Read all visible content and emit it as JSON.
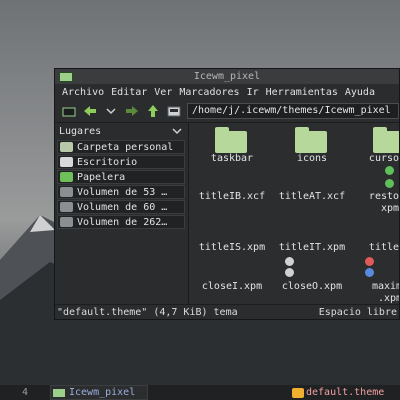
{
  "window": {
    "title": "Icewm_pixel"
  },
  "menu": [
    "Archivo",
    "Editar",
    "Ver",
    "Marcadores",
    "Ir",
    "Herramientas",
    "Ayuda"
  ],
  "toolbar": {
    "path": "/home/j/.icewm/themes/Icewm_pixel"
  },
  "sidebar": {
    "header": "Lugares",
    "items": [
      {
        "label": "Carpeta personal",
        "icon": "home-icon"
      },
      {
        "label": "Escritorio",
        "icon": "desktop-icon"
      },
      {
        "label": "Papelera",
        "icon": "trash-icon"
      },
      {
        "label": "Volumen de 53 …",
        "icon": "drive-icon"
      },
      {
        "label": "Volumen de 60 …",
        "icon": "drive-icon"
      },
      {
        "label": "Volumen de 262…",
        "icon": "drive-icon"
      }
    ]
  },
  "files": {
    "row1": [
      "taskbar",
      "icons",
      "cursors"
    ],
    "row2": [
      "titleIB.xcf",
      "titleAT.xcf",
      "restore",
      "xpm"
    ],
    "row3": [
      "titleIS.xpm",
      "titleIT.xpm",
      "titleAB"
    ],
    "row4": [
      "closeI.xpm",
      "closeO.xpm",
      "maximi",
      ".xpm"
    ]
  },
  "status": {
    "selected": "\"default.theme\" (4,7 KiB) tema",
    "free": "Espacio libre"
  },
  "taskbar": {
    "workspace": "4",
    "task1": "Icewm_pixel",
    "task2": "default.theme"
  },
  "colors": {
    "accent_green": "#9bcf8a",
    "folder": "#b6d89a",
    "taskbar_bg": "#1f2123"
  }
}
